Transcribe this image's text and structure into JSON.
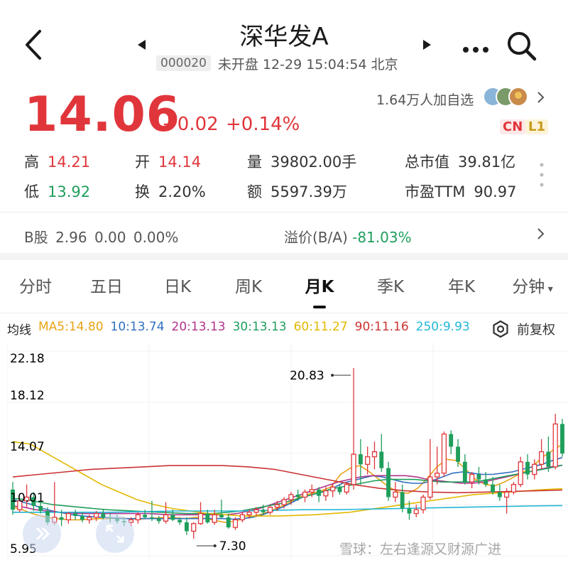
{
  "header": {
    "title": "深华发A",
    "code": "000020",
    "status": "未开盘 12-29 15:04:54 北京"
  },
  "quote": {
    "price": "14.06",
    "change": "+0.02",
    "change_pct": "+0.14%",
    "followers": "1.64万人加自选",
    "tag_cn": "CN",
    "tag_l1": "L1"
  },
  "stats": {
    "high_label": "高",
    "high": "14.21",
    "open_label": "开",
    "open": "14.14",
    "volume_label": "量",
    "volume": "39802.00手",
    "mktcap_label": "总市值",
    "mktcap": "39.81亿",
    "low_label": "低",
    "low": "13.92",
    "turnover_label": "换",
    "turnover": "2.20%",
    "amount_label": "额",
    "amount": "5597.39万",
    "pe_label": "市盈TTM",
    "pe": "90.97"
  },
  "bshare": {
    "text": "B股 2.96  0.00  0.00%",
    "premium_label": "溢价(B/A)",
    "premium_value": "-81.03%"
  },
  "tabs": [
    "分时",
    "五日",
    "日K",
    "周K",
    "月K",
    "季K",
    "年K",
    "分钟"
  ],
  "active_tab": "月K",
  "ma_legend": {
    "label": "均线",
    "items": [
      {
        "text": "MA5:14.80",
        "color": "#e8a317"
      },
      {
        "text": "10:13.74",
        "color": "#2f6fbf"
      },
      {
        "text": "20:13.13",
        "color": "#b0338c"
      },
      {
        "text": "30:13.13",
        "color": "#1f9e5c"
      },
      {
        "text": "60:11.27",
        "color": "#e2b800"
      },
      {
        "text": "90:11.16",
        "color": "#cc3333"
      },
      {
        "text": "250:9.93",
        "color": "#23b6d6"
      }
    ],
    "adjust": "前复权"
  },
  "chart_data": {
    "type": "candlestick",
    "y_ticks": [
      "22.18",
      "18.12",
      "14.07",
      "10.01",
      "5.95"
    ],
    "ylim": [
      5.95,
      22.18
    ],
    "max_label": "20.83",
    "min_label": "7.30",
    "candles": [
      [
        11.2,
        11.8,
        9.2,
        9.6
      ],
      [
        9.6,
        10.4,
        9.4,
        10.3
      ],
      [
        10.3,
        11.6,
        9.8,
        10.6
      ],
      [
        10.6,
        11.0,
        9.5,
        9.9
      ],
      [
        9.9,
        10.3,
        9.3,
        9.5
      ],
      [
        9.5,
        9.8,
        8.4,
        8.6
      ],
      [
        8.6,
        11.8,
        8.4,
        9.0
      ],
      [
        9.0,
        9.6,
        8.3,
        8.8
      ],
      [
        8.8,
        9.4,
        8.5,
        9.3
      ],
      [
        9.3,
        9.6,
        8.8,
        9.1
      ],
      [
        9.1,
        9.4,
        8.6,
        8.8
      ],
      [
        8.8,
        9.2,
        8.5,
        9.0
      ],
      [
        9.0,
        9.5,
        8.7,
        9.3
      ],
      [
        9.3,
        9.6,
        8.8,
        9.0
      ],
      [
        9.0,
        9.3,
        8.6,
        8.9
      ],
      [
        8.9,
        9.2,
        8.5,
        8.7
      ],
      [
        8.7,
        9.0,
        8.3,
        8.6
      ],
      [
        8.6,
        9.0,
        8.3,
        8.8
      ],
      [
        8.8,
        9.4,
        8.5,
        9.2
      ],
      [
        9.2,
        9.6,
        8.9,
        9.0
      ],
      [
        9.0,
        10.3,
        8.7,
        8.9
      ],
      [
        8.9,
        9.1,
        8.5,
        8.7
      ],
      [
        8.7,
        10.2,
        8.5,
        9.2
      ],
      [
        9.2,
        9.6,
        8.7,
        8.8
      ],
      [
        8.8,
        9.0,
        8.4,
        8.6
      ],
      [
        8.6,
        9.0,
        7.6,
        7.9
      ],
      [
        7.9,
        8.6,
        7.3,
        8.5
      ],
      [
        8.5,
        10.2,
        8.4,
        9.3
      ],
      [
        9.3,
        9.6,
        8.5,
        8.6
      ],
      [
        8.6,
        9.6,
        8.4,
        9.2
      ],
      [
        9.2,
        10.4,
        8.9,
        9.0
      ],
      [
        9.0,
        9.3,
        8.1,
        8.2
      ],
      [
        8.2,
        9.0,
        8.0,
        8.8
      ],
      [
        8.8,
        9.4,
        8.6,
        9.2
      ],
      [
        9.2,
        9.6,
        8.9,
        9.4
      ],
      [
        9.4,
        9.8,
        9.1,
        9.6
      ],
      [
        9.6,
        10.0,
        9.2,
        9.4
      ],
      [
        9.4,
        9.9,
        9.2,
        9.8
      ],
      [
        9.8,
        10.3,
        9.5,
        10.0
      ],
      [
        10.0,
        10.6,
        9.7,
        10.4
      ],
      [
        10.4,
        11.0,
        10.0,
        10.8
      ],
      [
        10.8,
        11.2,
        10.3,
        10.6
      ],
      [
        10.6,
        11.2,
        10.2,
        11.0
      ],
      [
        11.0,
        11.6,
        10.6,
        11.2
      ],
      [
        11.2,
        11.4,
        10.2,
        10.7
      ],
      [
        10.7,
        11.4,
        10.3,
        11.1
      ],
      [
        11.1,
        11.6,
        10.6,
        11.4
      ],
      [
        11.4,
        11.6,
        10.8,
        11.0
      ],
      [
        11.0,
        11.8,
        10.8,
        11.6
      ],
      [
        11.6,
        20.83,
        11.2,
        14.0
      ],
      [
        14.0,
        15.2,
        11.6,
        13.2
      ],
      [
        13.2,
        14.6,
        12.4,
        13.8
      ],
      [
        13.8,
        15.0,
        12.8,
        14.2
      ],
      [
        14.2,
        15.6,
        12.6,
        12.9
      ],
      [
        12.9,
        13.4,
        10.3,
        10.6
      ],
      [
        10.6,
        11.8,
        10.2,
        11.0
      ],
      [
        11.0,
        11.6,
        9.4,
        9.7
      ],
      [
        9.7,
        10.3,
        8.8,
        9.3
      ],
      [
        9.3,
        10.0,
        9.0,
        9.6
      ],
      [
        9.6,
        10.8,
        9.3,
        10.6
      ],
      [
        10.6,
        15.2,
        10.4,
        12.2
      ],
      [
        12.2,
        14.6,
        11.6,
        12.5
      ],
      [
        12.5,
        15.8,
        12.2,
        15.6
      ],
      [
        15.6,
        15.9,
        14.0,
        14.6
      ],
      [
        14.6,
        15.2,
        13.0,
        13.4
      ],
      [
        13.4,
        14.0,
        11.6,
        11.8
      ],
      [
        11.8,
        12.6,
        11.3,
        12.4
      ],
      [
        12.4,
        13.0,
        11.6,
        12.0
      ],
      [
        12.0,
        12.6,
        11.4,
        11.6
      ],
      [
        11.6,
        12.2,
        10.8,
        11.0
      ],
      [
        11.0,
        11.6,
        10.3,
        10.6
      ],
      [
        10.6,
        11.3,
        9.3,
        11.0
      ],
      [
        11.0,
        11.8,
        10.8,
        11.6
      ],
      [
        11.6,
        13.8,
        11.4,
        13.4
      ],
      [
        13.4,
        14.0,
        12.0,
        12.4
      ],
      [
        12.4,
        13.6,
        12.0,
        13.2
      ],
      [
        13.2,
        15.2,
        12.8,
        14.2
      ],
      [
        14.2,
        15.4,
        12.6,
        13.0
      ],
      [
        13.0,
        17.2,
        12.8,
        16.4
      ],
      [
        16.4,
        16.8,
        13.8,
        14.06
      ]
    ],
    "ma_series": [
      {
        "name": "MA5",
        "color": "#e8a317",
        "values": [
          9.8,
          9.6,
          9.3,
          9.1,
          8.95,
          8.85,
          8.8,
          8.8,
          8.85,
          8.9,
          8.9,
          8.95,
          8.9,
          8.85,
          8.9,
          8.95,
          9.0,
          8.95,
          8.9,
          9.0,
          8.9,
          8.75,
          8.6,
          8.7,
          8.9,
          9.1,
          9.3,
          9.6,
          9.9,
          10.3,
          10.7,
          10.9,
          11.1,
          11.4,
          12.4,
          12.9,
          13.1,
          12.6,
          12.0,
          11.4,
          11.0,
          10.9,
          11.3,
          12.1,
          13.0,
          13.6,
          13.5,
          12.8,
          12.0,
          11.6,
          11.5,
          11.8,
          12.2,
          12.6,
          13.1,
          13.8,
          14.3,
          14.8
        ]
      },
      {
        "name": "MA10",
        "color": "#2f6fbf",
        "values": [
          10.4,
          10.2,
          10.0,
          9.7,
          9.5,
          9.35,
          9.2,
          9.1,
          9.05,
          9.0,
          8.95,
          8.9,
          8.9,
          8.9,
          8.9,
          8.9,
          8.9,
          8.9,
          8.9,
          8.9,
          8.9,
          8.9,
          8.85,
          8.9,
          9.0,
          9.2,
          9.5,
          9.8,
          10.2,
          10.6,
          10.8,
          11.0,
          11.3,
          11.7,
          11.9,
          12.1,
          12.3,
          12.2,
          12.0,
          11.8,
          11.7,
          11.7,
          11.9,
          12.2,
          12.5,
          12.6,
          12.5,
          12.4,
          12.4,
          12.5,
          12.6,
          12.8,
          13.0,
          13.2,
          13.5,
          13.74
        ]
      },
      {
        "name": "MA20",
        "color": "#b0338c",
        "values": [
          9.9,
          9.8,
          9.6,
          9.5,
          9.4,
          9.35,
          9.3,
          9.3,
          9.3,
          9.3,
          9.3,
          9.3,
          9.3,
          9.25,
          9.2,
          9.2,
          9.2,
          9.2,
          9.2,
          9.2,
          9.3,
          9.5,
          9.7,
          10.0,
          10.3,
          10.6,
          10.9,
          11.2,
          11.5,
          11.8,
          12.0,
          12.2,
          12.3,
          12.3,
          12.3,
          12.3,
          12.2,
          12.0,
          11.9,
          11.8,
          11.7,
          11.7,
          11.8,
          12.0,
          12.2,
          12.4,
          12.6,
          12.8,
          13.0,
          13.13
        ]
      },
      {
        "name": "MA30",
        "color": "#1f9e5c",
        "values": [
          10.5,
          10.4,
          10.2,
          10.0,
          9.9,
          9.8,
          9.7,
          9.6,
          9.55,
          9.5,
          9.45,
          9.4,
          9.35,
          9.3,
          9.3,
          9.3,
          9.4,
          9.5,
          9.7,
          9.9,
          10.1,
          10.4,
          10.7,
          11.0,
          11.3,
          11.5,
          11.7,
          11.9,
          12.0,
          12.0,
          12.0,
          11.9,
          11.8,
          11.8,
          11.8,
          11.9,
          12.1,
          12.3,
          12.5,
          12.7,
          12.9,
          13.13
        ]
      },
      {
        "name": "MA60",
        "color": "#e2b800",
        "values": [
          15.0,
          14.8,
          14.0,
          13.2,
          12.4,
          11.6,
          11.0,
          10.4,
          10.0,
          9.7,
          9.5,
          9.3,
          9.2,
          9.1,
          9.1,
          9.1,
          9.15,
          9.2,
          9.3,
          9.4,
          9.6,
          9.8,
          10.0,
          10.2,
          10.4,
          10.6,
          10.8,
          10.9,
          11.0,
          11.1,
          11.2,
          11.27
        ]
      },
      {
        "name": "MA90",
        "color": "#cc3333",
        "values": [
          12.2,
          12.4,
          12.6,
          12.8,
          12.9,
          13.0,
          13.1,
          13.1,
          13.1,
          13.0,
          12.8,
          12.4,
          12.0,
          11.6,
          11.3,
          11.1,
          11.0,
          10.95,
          11.0,
          11.05,
          11.1,
          11.16
        ]
      },
      {
        "name": "MA250",
        "color": "#23b6d6",
        "values": [
          9.4,
          9.4,
          9.4,
          9.4,
          9.45,
          9.5,
          9.5,
          9.5,
          9.55,
          9.6,
          9.6,
          9.65,
          9.7,
          9.75,
          9.8,
          9.85,
          9.9,
          9.93
        ]
      }
    ]
  },
  "watermark": "雪球：左右逢源又财源广进",
  "colors": {
    "up": "#e0363b",
    "down": "#1f9e5c"
  },
  "icons": [
    "back-icon",
    "prev-stock-icon",
    "next-stock-icon",
    "more-icon",
    "search-icon",
    "chevron-right-icon",
    "settings-icon",
    "double-chevron-icon",
    "expand-icon"
  ]
}
